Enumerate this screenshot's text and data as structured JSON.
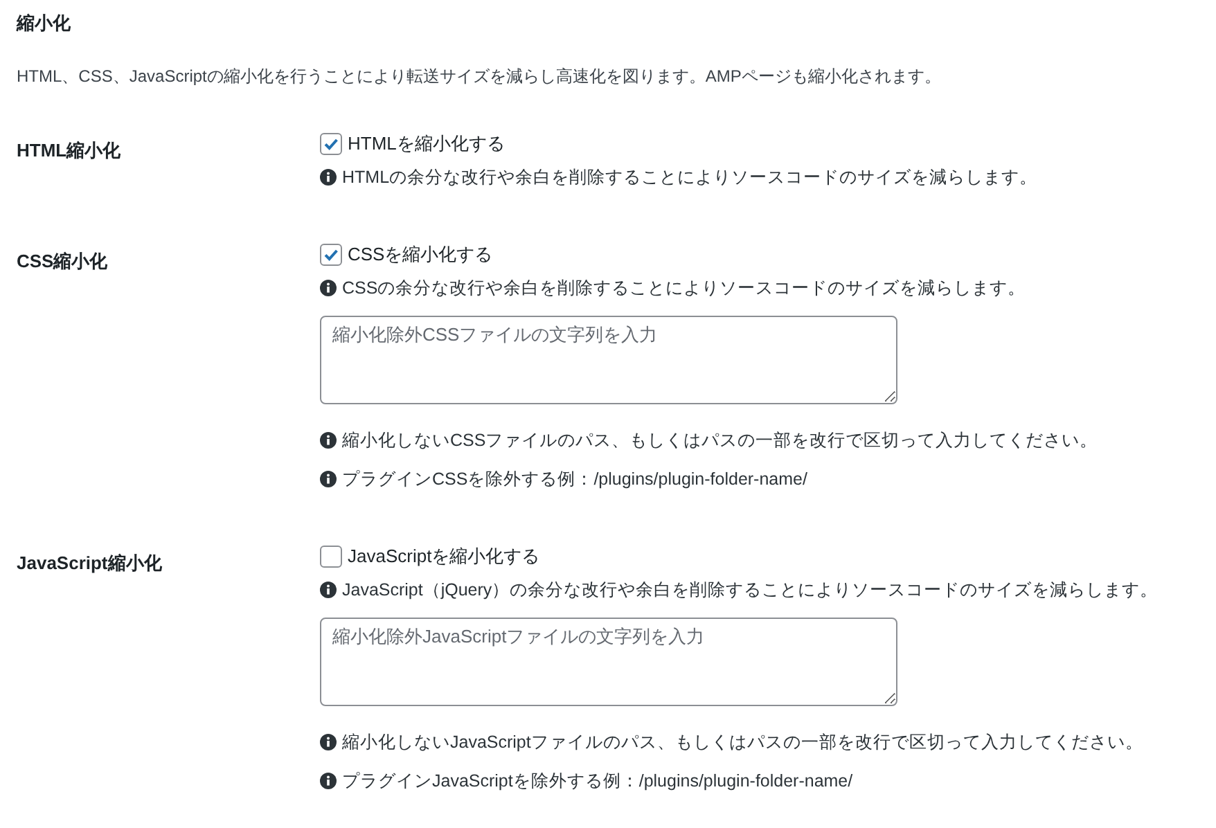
{
  "heading": "縮小化",
  "description": "HTML、CSS、JavaScriptの縮小化を行うことにより転送サイズを減らし高速化を図ります。AMPページも縮小化されます。",
  "settings": [
    {
      "label": "HTML縮小化",
      "option": {
        "label": "HTMLを縮小化する",
        "checked": true
      },
      "hint": "HTMLの余分な改行や余白を削除することによりソースコードのサイズを減らします。"
    },
    {
      "label": "CSS縮小化",
      "option": {
        "label": "CSSを縮小化する",
        "checked": true
      },
      "hint": "CSSの余分な改行や余白を削除することによりソースコードのサイズを減らします。",
      "exclude_field": {
        "placeholder": "縮小化除外CSSファイルの文字列を入力"
      },
      "notes": [
        "縮小化しないCSSファイルのパス、もしくはパスの一部を改行で区切って入力してください。",
        "プラグインCSSを除外する例：/plugins/plugin-folder-name/"
      ]
    },
    {
      "label": "JavaScript縮小化",
      "option": {
        "label": "JavaScriptを縮小化する",
        "checked": false
      },
      "hint": "JavaScript（jQuery）の余分な改行や余白を削除することによりソースコードのサイズを減らします。",
      "exclude_field": {
        "placeholder": "縮小化除外JavaScriptファイルの文字列を入力"
      },
      "notes": [
        "縮小化しないJavaScriptファイルのパス、もしくはパスの一部を改行で区切って入力してください。",
        "プラグインJavaScriptを除外する例：/plugins/plugin-folder-name/"
      ]
    }
  ]
}
